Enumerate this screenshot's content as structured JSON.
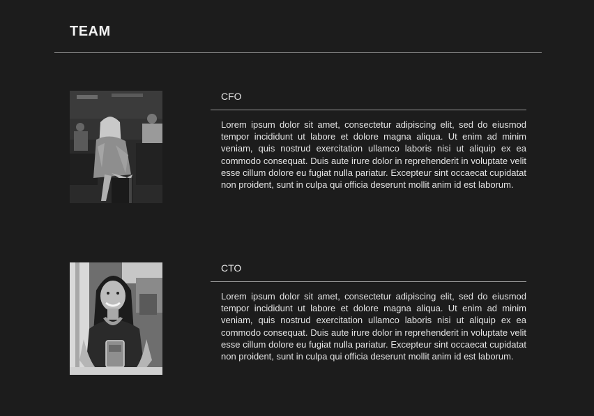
{
  "page": {
    "title": "TEAM"
  },
  "team": [
    {
      "role": "CFO",
      "bio": "Lorem ipsum dolor sit amet, consectetur adipiscing elit, sed do eiusmod tempor incididunt ut labore et dolore magna aliqua. Ut enim ad minim veniam, quis nostrud exercitation ullamco laboris nisi ut aliquip ex ea commodo consequat. Duis aute irure dolor in reprehenderit in voluptate velit esse cillum dolore eu fugiat nulla pariatur. Excepteur sint occaecat cupidatat non proident, sunt in culpa qui officia deserunt mollit anim id est laborum."
    },
    {
      "role": "CTO",
      "bio": "Lorem ipsum dolor sit amet, consectetur adipiscing elit, sed do eiusmod tempor incididunt ut labore et dolore magna aliqua. Ut enim ad minim veniam, quis nostrud exercitation ullamco laboris nisi ut aliquip ex ea commodo consequat. Duis aute irure dolor in reprehenderit in voluptate velit esse cillum dolore eu fugiat nulla pariatur. Excepteur sint occaecat cupidatat non proident, sunt in culpa qui officia deserunt mollit anim id est laborum."
    }
  ],
  "colors": {
    "background": "#1c1c1c",
    "text": "#e6e6e6",
    "divider": "#8a8a8a"
  }
}
